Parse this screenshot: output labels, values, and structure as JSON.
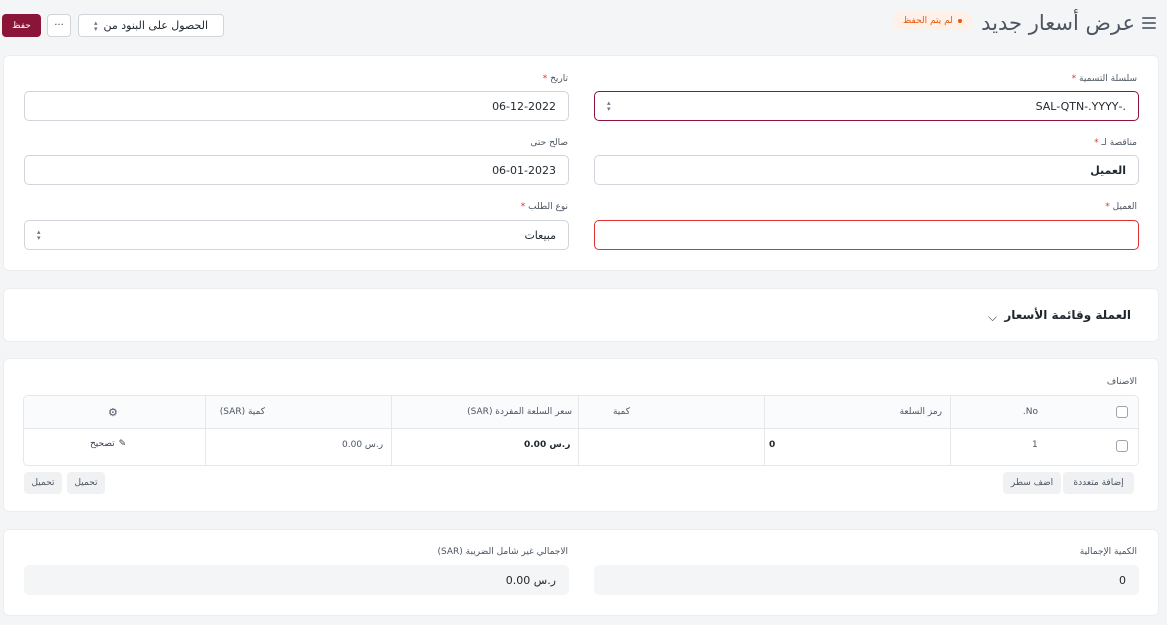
{
  "header": {
    "title": "عرض أسعار جديد",
    "status_badge": "لم يتم الحفظ",
    "save_label": "حفظ",
    "more_label": "···",
    "get_items_label": "الحصول على البنود من"
  },
  "details": {
    "naming_series": {
      "label": "سلسلة التسمية",
      "value": ".-SAL-QTN-.YYYY"
    },
    "date": {
      "label": "تاريخ",
      "value": "06-12-2022"
    },
    "quotation_to": {
      "label": "مناقصة لـ",
      "value": "العميل"
    },
    "valid_till": {
      "label": "صالح حتى",
      "value": "06-01-2023"
    },
    "customer": {
      "label": "العميل",
      "value": ""
    },
    "order_type": {
      "label": "نوع الطلب",
      "value": "مبيعات"
    },
    "required_mark": "*"
  },
  "currency_section": {
    "title": "العملة وقائمة الأسعار",
    "chevron": "⌵"
  },
  "items": {
    "label": "الاصناف",
    "columns": [
      "No.",
      "رمز السلعة",
      "كمية",
      "سعر السلعة المفردة (SAR)",
      "كمية (SAR)"
    ],
    "rows": [
      {
        "no": "1",
        "item_code": "",
        "qty": "0",
        "rate": "ر.س 0.00",
        "amount": "ر.س 0.00",
        "edit": "تصحيح"
      }
    ],
    "add_multiple": "إضافة متعددة",
    "add_row": "اضف سطر",
    "download": "تحميل",
    "upload": "تحميل"
  },
  "totals": {
    "total_qty": {
      "label": "الكمية الإجمالية",
      "value": "0"
    },
    "net_total": {
      "label": "الاجمالي غير شامل الضريبة (SAR)",
      "value": "ر.س 0.00"
    }
  },
  "colors": {
    "primary": "#8b1538",
    "warning": "#e8590c",
    "error": "#e03131"
  },
  "icons": [
    "menu-icon",
    "gear-icon",
    "pencil-icon",
    "chevron-down-icon",
    "updown-icon"
  ]
}
